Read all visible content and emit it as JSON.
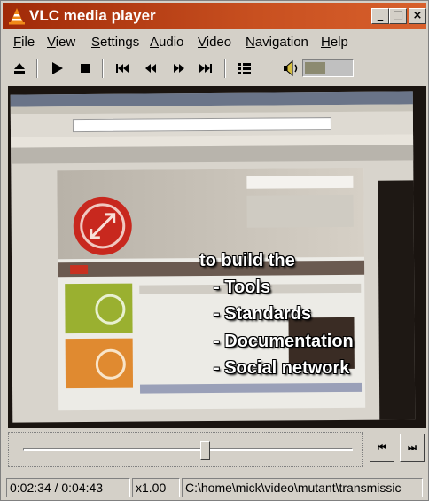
{
  "window": {
    "title": "VLC media player",
    "minimize_glyph": "_",
    "maximize_glyph": "□",
    "close_glyph": "×",
    "title_color": "#b43a12"
  },
  "menu": {
    "items": [
      {
        "label_u": "F",
        "label_rest": "ile"
      },
      {
        "label_u": "V",
        "label_rest": "iew"
      },
      {
        "label_u": "S",
        "label_rest": "ettings"
      },
      {
        "label_u": "A",
        "label_rest": "udio"
      },
      {
        "label_u": "V",
        "label_rest": "ideo"
      },
      {
        "label_u": "N",
        "label_rest": "avigation"
      },
      {
        "label_u": "H",
        "label_rest": "elp"
      }
    ]
  },
  "toolbar": {
    "icons": [
      "eject-icon",
      "play-icon",
      "stop-icon",
      "previous-icon",
      "rewind-icon",
      "fast-forward-icon",
      "next-icon",
      "playlist-icon",
      "volume-icon"
    ],
    "volume_level": 0.45
  },
  "video": {
    "captions": [
      "to build the",
      "- Tools",
      "- Standards",
      "- Documentation",
      "- Social network"
    ]
  },
  "seek": {
    "position_fraction": 0.55
  },
  "nav_buttons": {
    "prev_glyph": "⏮",
    "next_glyph": "⏭"
  },
  "status": {
    "time": "0:02:34 / 0:04:43",
    "speed": "x1.00",
    "path": "C:\\home\\mick\\video\\mutant\\transmissic"
  }
}
